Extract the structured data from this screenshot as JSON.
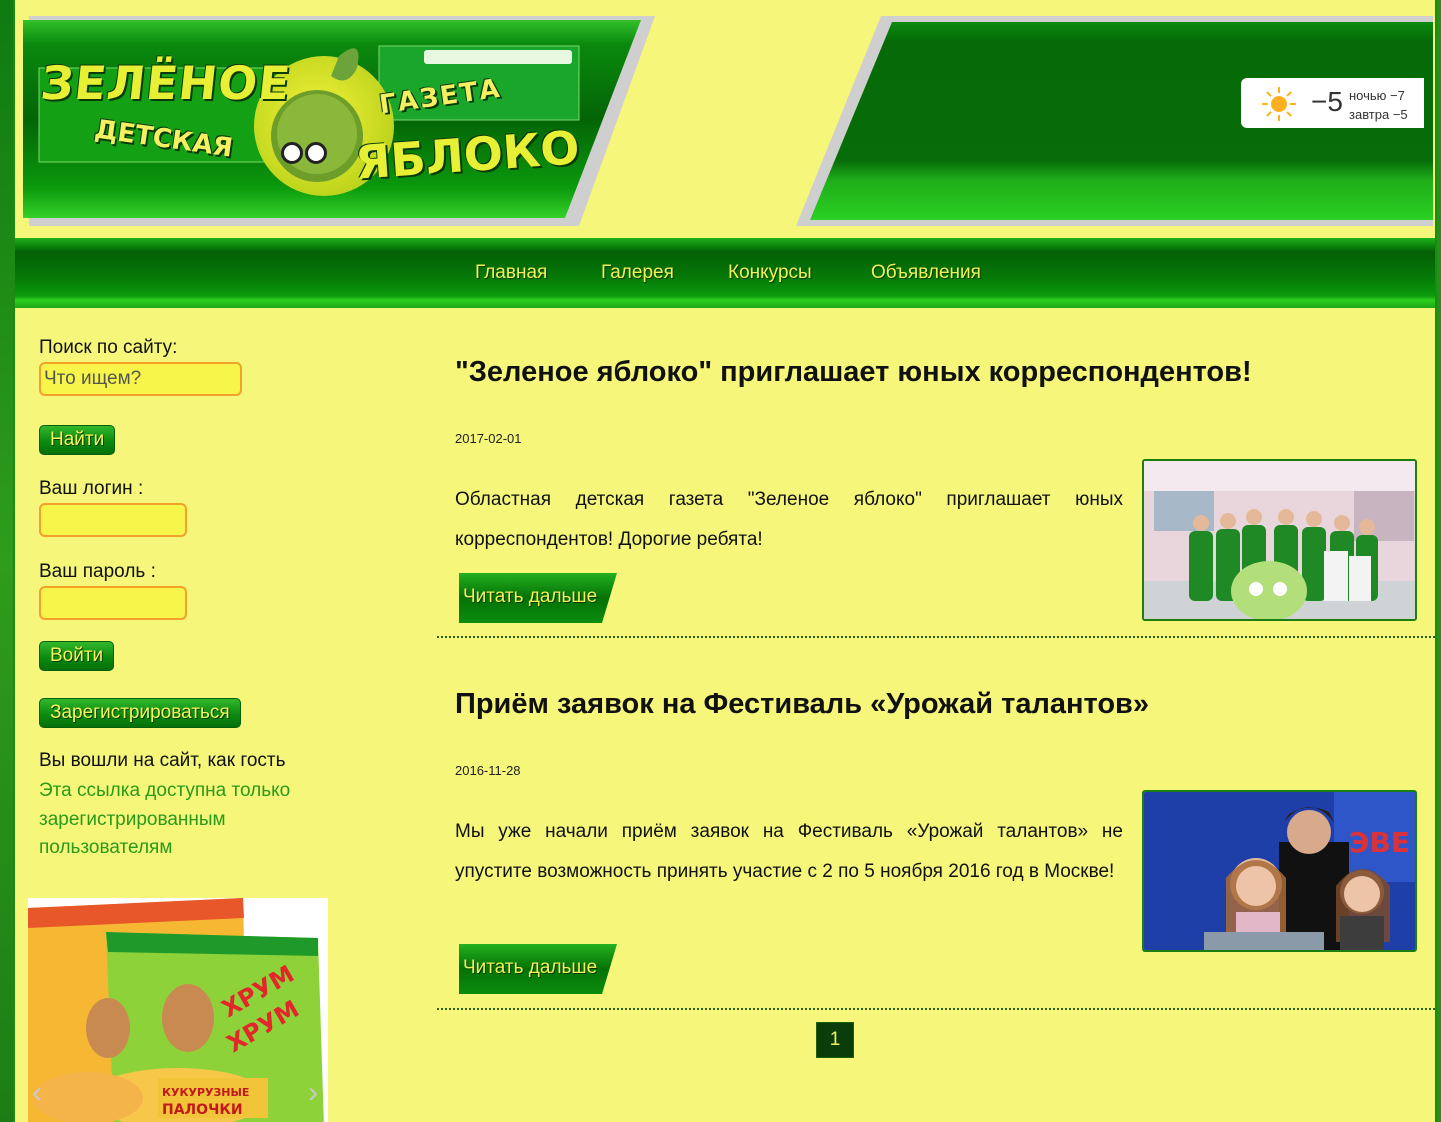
{
  "brand": {
    "line1": "ЗЕЛЁНОЕ",
    "line2": "ДЕТСКАЯ",
    "line3": "ГАЗЕТА",
    "line4": "ЯБЛОКО"
  },
  "weather": {
    "icon": "sun-icon",
    "temp": "−5",
    "night": "ночью −7",
    "tomorrow": "завтра −5"
  },
  "nav": {
    "items": [
      {
        "label": "Главная"
      },
      {
        "label": "Галерея"
      },
      {
        "label": "Конкурсы"
      },
      {
        "label": "Объявления"
      }
    ]
  },
  "sidebar": {
    "search_label": "Поиск по сайту:",
    "search_placeholder": "Что ищем?",
    "search_button": "Найти",
    "login_label": "Ваш логин :",
    "password_label": "Ваш пароль :",
    "login_button": "Войти",
    "register_button": "Зарегистрироваться",
    "guest_text": "Вы вошли на сайт, как гость",
    "guest_link": "Эта ссылка доступна только зарегистрированным пользователям"
  },
  "articles": [
    {
      "title": "\"Зеленое яблоко\" приглашает юных корреспондентов!",
      "date": "2017-02-01",
      "text": "Областная детская газета \"Зеленое яблоко\" приглашает юных корреспондентов! Дорогие ребята!",
      "read_more": "Читать дальше"
    },
    {
      "title": "Приём заявок на Фестиваль «Урожай талантов»",
      "date": "2016-11-28",
      "text": "Мы уже начали приём заявок на Фестиваль «Урожай талантов» не упустите возможность принять участие с 2 по 5 ноября 2016 год в Москве!",
      "read_more": "Читать дальше"
    }
  ],
  "pagination": {
    "current": "1"
  },
  "colors": {
    "page_bg": "#f6f77a",
    "nav_text": "#f4f05a",
    "accent_green": "#0c8a10",
    "link_green": "#2b9a1a"
  }
}
